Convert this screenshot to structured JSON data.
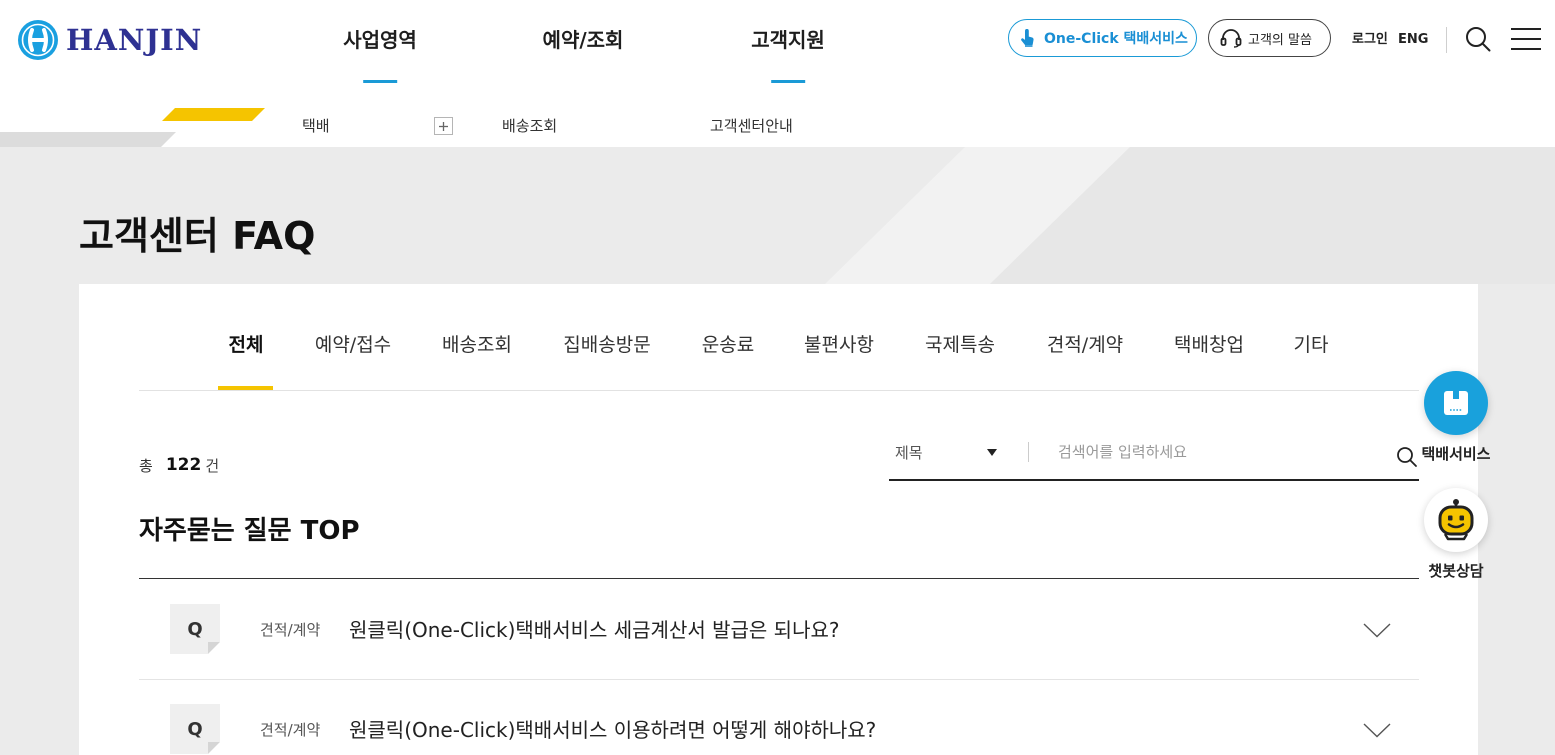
{
  "header": {
    "logo": {
      "text": "HANJIN",
      "icon": "hanjin-logo-icon"
    },
    "nav": [
      {
        "label": "사업영역"
      },
      {
        "label": "예약/조회"
      },
      {
        "label": "고객지원"
      }
    ],
    "one_click": {
      "label": "One-Click 택배서비스",
      "icon": "hand-pointer-icon"
    },
    "customer_voice": {
      "label": "고객의 말씀",
      "icon": "headset-icon"
    },
    "login_label": "로그인",
    "lang_label": "ENG",
    "search_icon": "search-icon",
    "menu_icon": "hamburger-menu-icon"
  },
  "subnav": {
    "items": [
      {
        "label": "택배"
      },
      {
        "label": "배송조회"
      },
      {
        "label": "고객센터안내"
      }
    ],
    "expand_icon": "plus-icon"
  },
  "page": {
    "title": "고객센터 FAQ"
  },
  "tabs": [
    {
      "label": "전체",
      "selected": true
    },
    {
      "label": "예약/접수",
      "selected": false
    },
    {
      "label": "배송조회",
      "selected": false
    },
    {
      "label": "집배송방문",
      "selected": false
    },
    {
      "label": "운송료",
      "selected": false
    },
    {
      "label": "불편사항",
      "selected": false
    },
    {
      "label": "국제특송",
      "selected": false
    },
    {
      "label": "견적/계약",
      "selected": false
    },
    {
      "label": "택배창업",
      "selected": false
    },
    {
      "label": "기타",
      "selected": false
    }
  ],
  "summary": {
    "prefix": "총",
    "count": "122",
    "suffix": "건"
  },
  "search": {
    "field_value": "제목",
    "placeholder": "검색어를 입력하세요",
    "icon": "search-icon"
  },
  "top_faq": {
    "heading": "자주묻는 질문 TOP",
    "items": [
      {
        "marker": "Q",
        "category": "견적/계약",
        "question": "원클릭(One-Click)택배서비스 세금계산서 발급은 되나요?",
        "icon": "chevron-down-icon"
      },
      {
        "marker": "Q",
        "category": "견적/계약",
        "question": "원클릭(One-Click)택배서비스 이용하려면 어떻게 해야하나요?",
        "icon": "chevron-down-icon"
      }
    ]
  },
  "floating": {
    "parcel": {
      "label": "택배서비스",
      "icon": "parcel-box-icon"
    },
    "chatbot": {
      "label": "챗봇상담",
      "icon": "chatbot-icon"
    }
  },
  "colors": {
    "brand_blue": "#1a9ad6",
    "brand_navy": "#2e3192",
    "accent_yellow": "#f5c400",
    "background_gray": "#ebebeb"
  }
}
